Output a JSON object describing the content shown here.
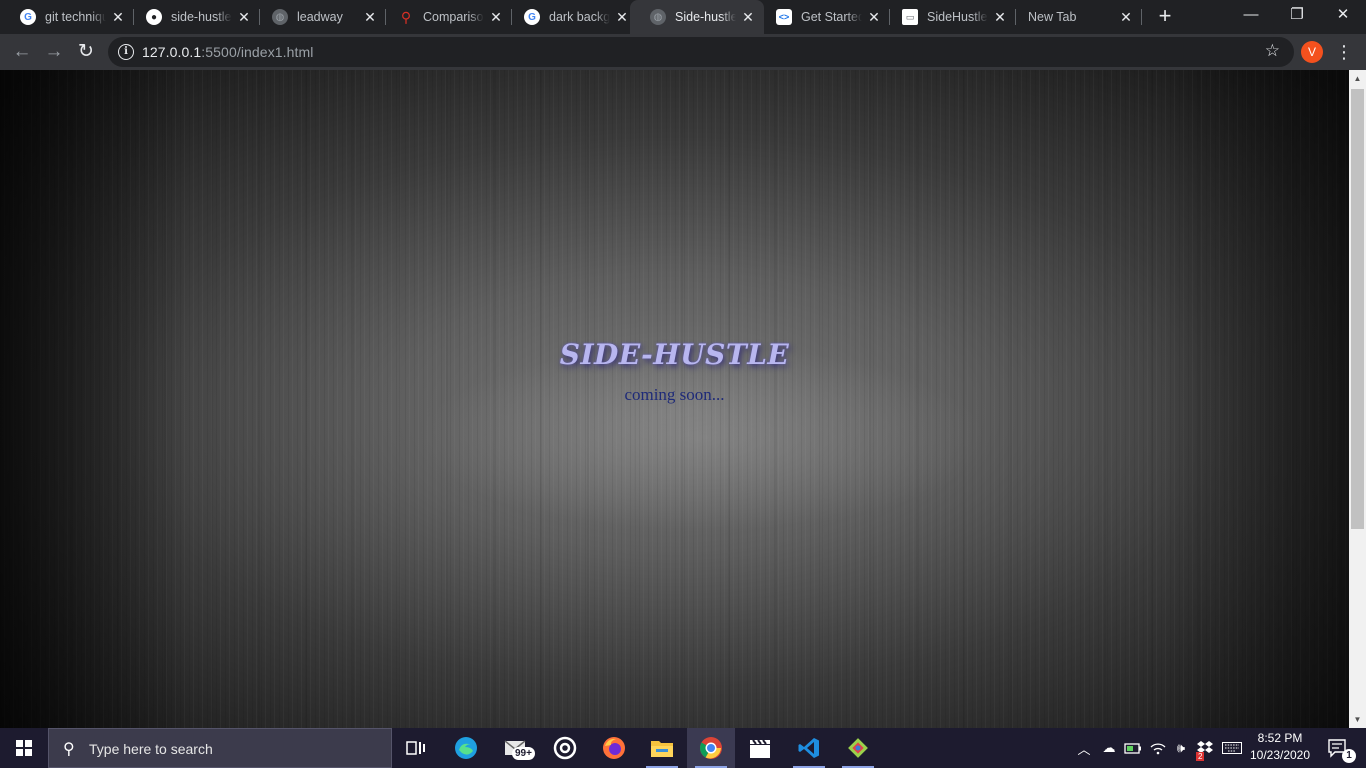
{
  "browser": {
    "tabs": [
      {
        "title": "git technique",
        "favicon": "google-icon",
        "active": false
      },
      {
        "title": "side-hustle",
        "favicon": "github-icon",
        "active": false
      },
      {
        "title": "leadway",
        "favicon": "globe-icon",
        "active": false
      },
      {
        "title": "Comparison",
        "favicon": "comparison-icon",
        "active": false
      },
      {
        "title": "dark background",
        "favicon": "google-icon",
        "active": false
      },
      {
        "title": "Side-hustle",
        "favicon": "globe-icon",
        "active": true
      },
      {
        "title": "Get Started",
        "favicon": "code-icon",
        "active": false
      },
      {
        "title": "SideHustle",
        "favicon": "page-icon",
        "active": false
      },
      {
        "title": "New Tab",
        "favicon": "none",
        "active": false
      }
    ],
    "window_controls": {
      "minimize": "—",
      "restore": "❐",
      "close": "✕"
    },
    "address": {
      "host": "127.0.0.1",
      "rest": ":5500/index1.html"
    },
    "profile_initial": "V",
    "accent": "#f4511e"
  },
  "page": {
    "title": "SIDE-HUSTLE",
    "subtitle": "coming soon..."
  },
  "taskbar": {
    "search_placeholder": "Type here to search",
    "mail_badge": "99+",
    "clock_time": "8:52 PM",
    "clock_date": "10/23/2020",
    "notification_count": "1",
    "tray_badge": "2"
  }
}
